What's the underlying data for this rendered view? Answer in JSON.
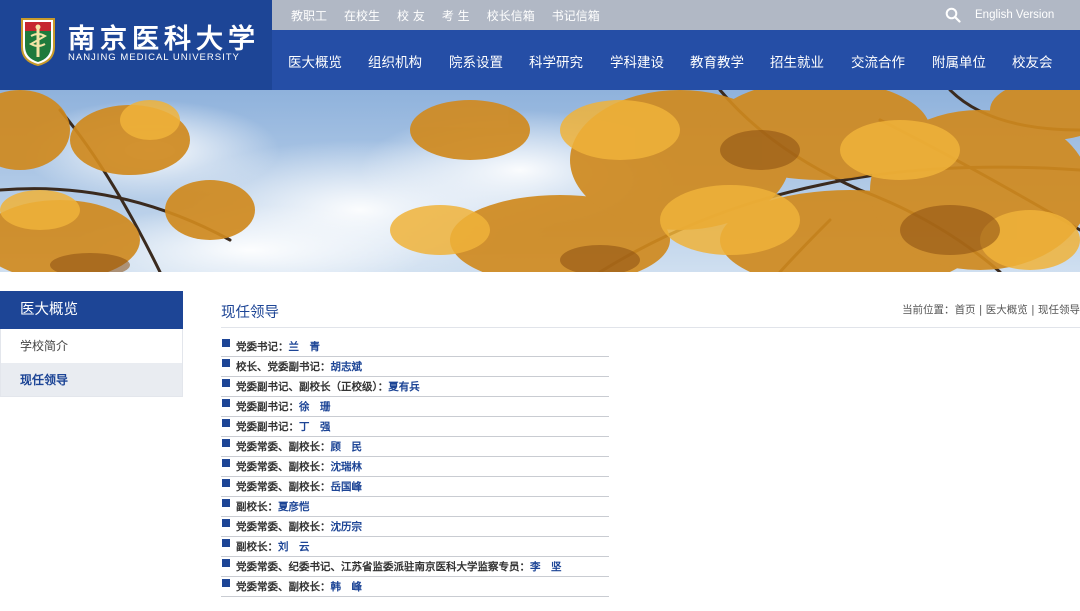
{
  "brand": {
    "name_cn": "南京医科大学",
    "name_en": "NANJING MEDICAL UNIVERSITY"
  },
  "top_links": [
    "教职工",
    "在校生",
    "校 友",
    "考 生",
    "校长信箱",
    "书记信箱"
  ],
  "english_label": "English Version",
  "nav": [
    "医大概览",
    "组织机构",
    "院系设置",
    "科学研究",
    "学科建设",
    "教育教学",
    "招生就业",
    "交流合作",
    "附属单位",
    "校友会"
  ],
  "sidebar": {
    "title": "医大概览",
    "items": [
      "学校简介",
      "现任领导"
    ],
    "active_index": 1
  },
  "content": {
    "title": "现任领导",
    "breadcrumb": {
      "prefix": "当前位置：",
      "home": "首页",
      "sep": " | ",
      "section": "医大概览",
      "current": "现任领导"
    },
    "leaders": [
      {
        "role": "党委书记：",
        "name": "兰　青"
      },
      {
        "role": "校长、党委副书记：",
        "name": "胡志斌"
      },
      {
        "role": "党委副书记、副校长（正校级）：",
        "name": "夏有兵"
      },
      {
        "role": "党委副书记：",
        "name": "徐　珊"
      },
      {
        "role": "党委副书记：",
        "name": "丁　强"
      },
      {
        "role": "党委常委、副校长：",
        "name": "顾　民"
      },
      {
        "role": "党委常委、副校长：",
        "name": "沈瑞林"
      },
      {
        "role": "党委常委、副校长：",
        "name": "岳国峰"
      },
      {
        "role": "副校长：",
        "name": "夏彦恺"
      },
      {
        "role": "党委常委、副校长：",
        "name": "沈历宗"
      },
      {
        "role": "副校长：",
        "name": "刘　云"
      },
      {
        "role": "党委常委、纪委书记、江苏省监委派驻南京医科大学监察专员：",
        "name": "李　坚"
      },
      {
        "role": "党委常委、副校长：",
        "name": "韩　峰"
      }
    ]
  },
  "colors": {
    "primary_blue": "#1d4596",
    "nav_blue": "#254ea6",
    "topbar_gray": "#b1b8c5"
  }
}
